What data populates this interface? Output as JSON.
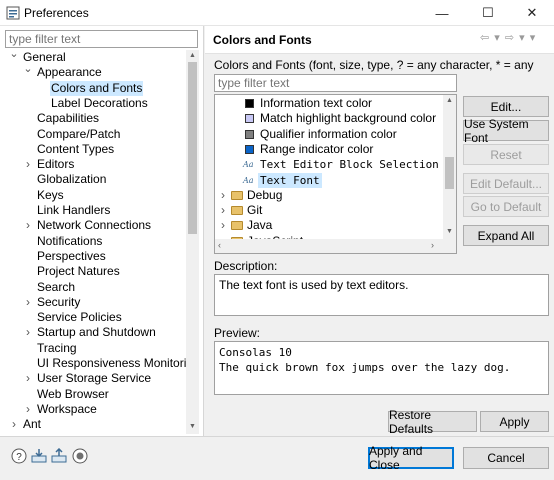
{
  "window": {
    "title": "Preferences",
    "minimize_glyph": "—",
    "maximize_glyph": "☐",
    "close_glyph": "✕"
  },
  "left": {
    "filter_placeholder": "type filter text",
    "tree": [
      {
        "label": "General",
        "level": 0,
        "twist": "open"
      },
      {
        "label": "Appearance",
        "level": 1,
        "twist": "open"
      },
      {
        "label": "Colors and Fonts",
        "level": 2,
        "twist": "",
        "selected": true
      },
      {
        "label": "Label Decorations",
        "level": 2,
        "twist": ""
      },
      {
        "label": "Capabilities",
        "level": 1,
        "twist": ""
      },
      {
        "label": "Compare/Patch",
        "level": 1,
        "twist": ""
      },
      {
        "label": "Content Types",
        "level": 1,
        "twist": ""
      },
      {
        "label": "Editors",
        "level": 1,
        "twist": "closed"
      },
      {
        "label": "Globalization",
        "level": 1,
        "twist": ""
      },
      {
        "label": "Keys",
        "level": 1,
        "twist": ""
      },
      {
        "label": "Link Handlers",
        "level": 1,
        "twist": ""
      },
      {
        "label": "Network Connections",
        "level": 1,
        "twist": "closed"
      },
      {
        "label": "Notifications",
        "level": 1,
        "twist": ""
      },
      {
        "label": "Perspectives",
        "level": 1,
        "twist": ""
      },
      {
        "label": "Project Natures",
        "level": 1,
        "twist": ""
      },
      {
        "label": "Search",
        "level": 1,
        "twist": ""
      },
      {
        "label": "Security",
        "level": 1,
        "twist": "closed"
      },
      {
        "label": "Service Policies",
        "level": 1,
        "twist": ""
      },
      {
        "label": "Startup and Shutdown",
        "level": 1,
        "twist": "closed"
      },
      {
        "label": "Tracing",
        "level": 1,
        "twist": ""
      },
      {
        "label": "UI Responsiveness Monitoring",
        "level": 1,
        "twist": ""
      },
      {
        "label": "User Storage Service",
        "level": 1,
        "twist": "closed"
      },
      {
        "label": "Web Browser",
        "level": 1,
        "twist": ""
      },
      {
        "label": "Workspace",
        "level": 1,
        "twist": "closed"
      },
      {
        "label": "Ant",
        "level": 0,
        "twist": "closed"
      }
    ]
  },
  "right": {
    "title": "Colors and Fonts",
    "nav_glyphs": "⇦ ▾ ⇨ ▾ ▾",
    "description": "Colors and Fonts (font, size, type, ? = any character, * = any string):",
    "filter_placeholder": "type filter text",
    "list": [
      {
        "label": "Information text color",
        "kind": "color",
        "color": "#000000"
      },
      {
        "label": "Match highlight background color",
        "kind": "color",
        "color": "#c8c8f5"
      },
      {
        "label": "Qualifier information color",
        "kind": "color",
        "color": "#808080"
      },
      {
        "label": "Range indicator color",
        "kind": "color",
        "color": "#0a64c8"
      },
      {
        "label": "Text Editor Block Selection Font",
        "kind": "font"
      },
      {
        "label": "Text Font",
        "kind": "font",
        "selected": true
      },
      {
        "label": "Debug",
        "kind": "folder"
      },
      {
        "label": "Git",
        "kind": "folder"
      },
      {
        "label": "Java",
        "kind": "folder"
      },
      {
        "label": "JavaScript",
        "kind": "folder"
      }
    ],
    "font_icon_text": "Aa",
    "buttons": {
      "edit": "Edit...",
      "use_system_font": "Use System Font",
      "reset": "Reset",
      "edit_default": "Edit Default...",
      "go_to_default": "Go to Default",
      "expand_all": "Expand All"
    },
    "description_label": "Description:",
    "description_text": "The text font is used by text editors.",
    "preview_label": "Preview:",
    "preview_lines": [
      "Consolas 10",
      "The quick brown fox jumps over the lazy dog."
    ],
    "restore_defaults": "Restore Defaults",
    "apply": "Apply"
  },
  "footer": {
    "apply_and_close": "Apply and Close",
    "cancel": "Cancel",
    "help_icon_glyph": "?"
  },
  "colors": {
    "selection": "#cce8ff",
    "accent": "#0078d7"
  }
}
